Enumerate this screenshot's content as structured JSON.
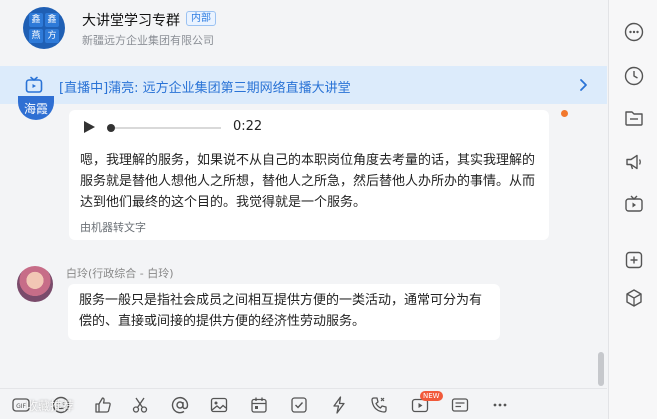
{
  "header": {
    "title": "大讲堂学习专群",
    "badge": "内部",
    "subtitle": "新疆远方企业集团有限公司",
    "avatar_chars": [
      "鑫",
      "鑫",
      "燕",
      "方"
    ]
  },
  "live_banner": {
    "text": "[直播中]蒲亮: 远方企业集团第三期网络直播大讲堂"
  },
  "messages": [
    {
      "avatar_text": "海霞",
      "voice_duration": "0:22",
      "body": "嗯，我理解的服务，如果说不从自己的本职岗位角度去考量的话，其实我理解的服务就是替他人想他人之所想，替他人之所急，然后替他人办所办的事情。从而达到他们最终的这个目的。我觉得就是一个服务。",
      "convert_label": "由机器转文字"
    },
    {
      "sender": "白玲(行政综合 - 白玲)",
      "body": "服务一般只是指社会成员之间相互提供方便的一类活动，通常可分为有偿的、直接或间接的提供方便的经济性劳动服务。"
    }
  ],
  "toolbar": {
    "new_badge": "NEW",
    "watermark": "收藏推荐",
    "icons": [
      "gif-icon",
      "emoji-icon",
      "like-icon",
      "scissors-icon",
      "at-icon",
      "image-icon",
      "calendar-icon",
      "checkbox-icon",
      "lightning-icon",
      "call-icon",
      "video-icon",
      "card-icon",
      "more-icon"
    ]
  },
  "sidebar": {
    "icons": [
      "more-icon",
      "history-icon",
      "folder-icon",
      "announcement-icon",
      "tv-icon",
      "add-app-icon",
      "box-icon"
    ]
  },
  "colors": {
    "accent": "#2a73d6",
    "banner_bg": "#dcebfb",
    "unread": "#f2782d"
  }
}
